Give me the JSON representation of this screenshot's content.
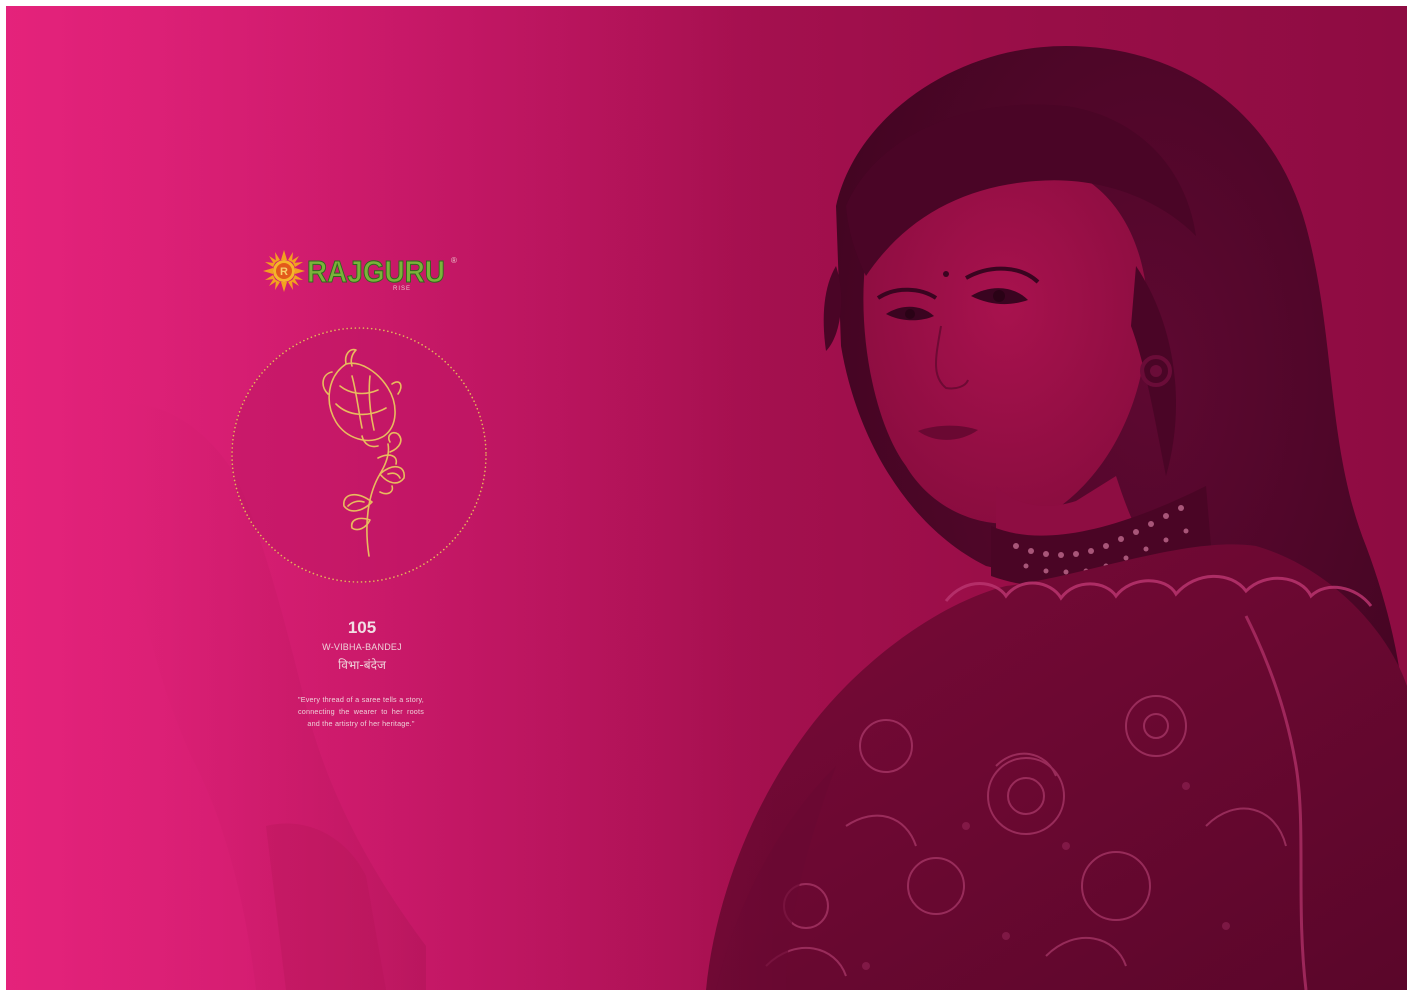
{
  "brand": {
    "name": "RAJGURU",
    "registered_mark": "®",
    "sub_text": "RISE"
  },
  "design": {
    "number": "105",
    "code": "W-VIBHA-BANDEJ",
    "name_hindi": "विभा-बंदेज"
  },
  "quote": "\"Every thread of a saree tells a story, connecting the wearer to her roots and the artistry of her heritage.\"",
  "colors": {
    "background_left": "#e0217a",
    "background_right": "#8e0c42",
    "ornament_gold": "#e5b35a",
    "logo_green": "#7ab33a",
    "logo_orange": "#f2a11f"
  },
  "icons": {
    "logo": "sun-emblem-icon",
    "ornament": "paisley-flower-icon"
  }
}
